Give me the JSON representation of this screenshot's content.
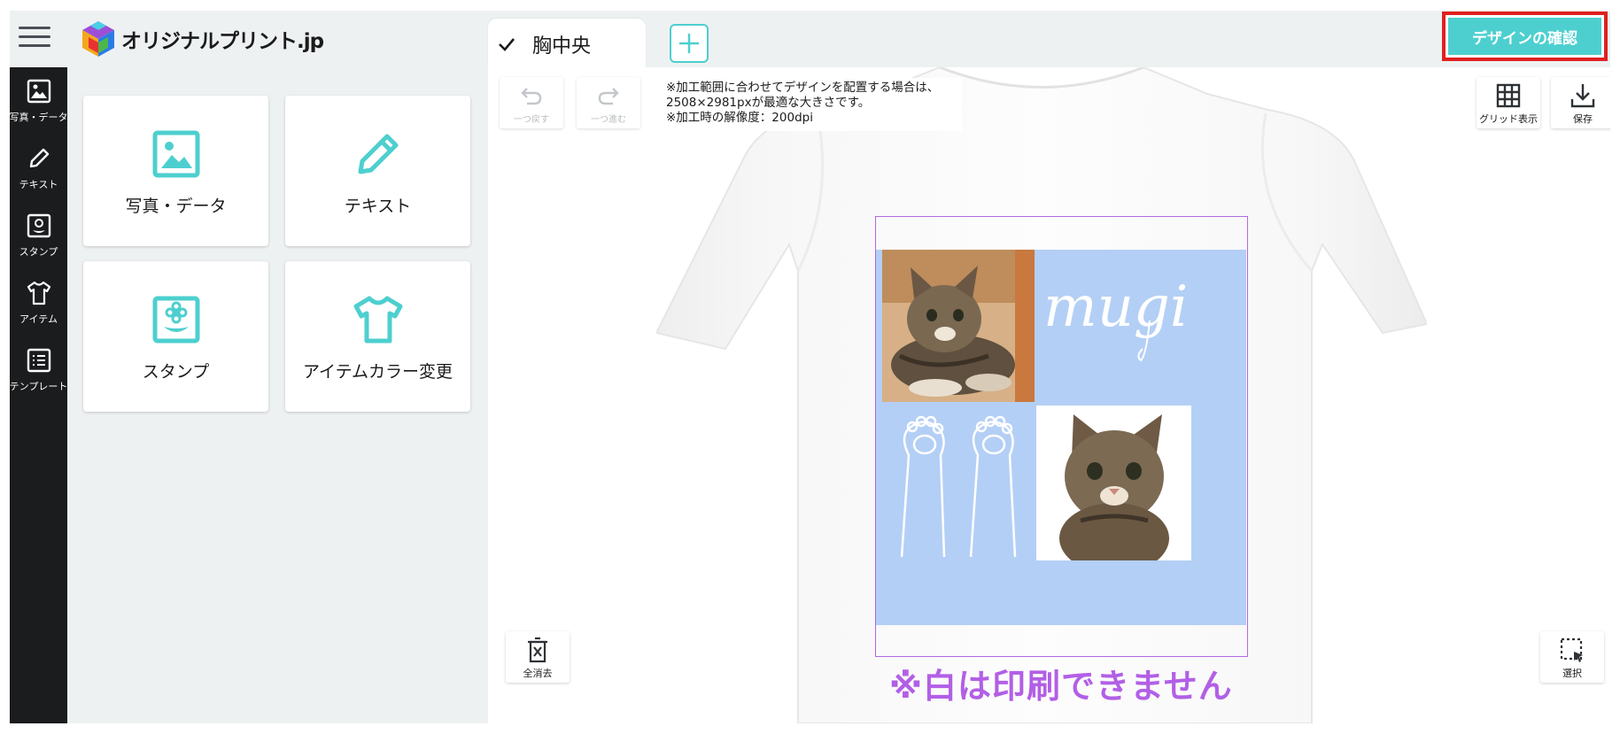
{
  "header": {
    "logo_text": "オリジナルプリント.jp",
    "tab_label": "胸中央",
    "confirm_label": "デザインの確認"
  },
  "sidebar": {
    "items": [
      {
        "label": "写真・データ",
        "icon": "image-icon"
      },
      {
        "label": "テキスト",
        "icon": "pencil-icon"
      },
      {
        "label": "スタンプ",
        "icon": "stamp-icon"
      },
      {
        "label": "アイテム",
        "icon": "tshirt-icon"
      },
      {
        "label": "テンプレート",
        "icon": "list-icon"
      }
    ]
  },
  "tools": {
    "cards": [
      {
        "label": "写真・データ",
        "icon": "image-icon"
      },
      {
        "label": "テキスト",
        "icon": "pencil-icon"
      },
      {
        "label": "スタンプ",
        "icon": "stamp-icon"
      },
      {
        "label": "アイテムカラー変更",
        "icon": "tshirt-icon"
      }
    ]
  },
  "canvas": {
    "undo_label": "一つ戻す",
    "redo_label": "一つ進む",
    "notice_lines": [
      "※加工範囲に合わせてデザインを配置する場合は、",
      "2508×2981pxが最適な大きさです。",
      "※加工時の解像度：200dpi"
    ],
    "grid_label": "グリッド表示",
    "save_label": "保存",
    "clear_label": "全消去",
    "select_label": "選択",
    "design_text": "mugi",
    "warning_text": "※白は印刷できません"
  },
  "colors": {
    "accent": "#4ecfcf",
    "highlight": "#e02020",
    "sidebar_bg": "#1a1c1e",
    "print_area": "#b269e0",
    "design_bg": "#b4cff5"
  }
}
